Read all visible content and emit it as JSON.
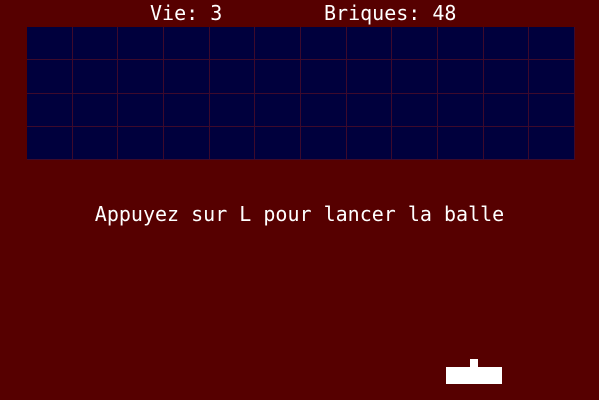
{
  "hud": {
    "lives": "Vie: 3",
    "bricks": "Briques: 48"
  },
  "game": {
    "lives_value": 3,
    "bricks_remaining": 48,
    "brick_rows": 4,
    "brick_columns": 12,
    "prompt": "Appuyez sur L pour lancer la balle"
  },
  "colors": {
    "background": "#560000",
    "bricks": "#00003d",
    "brick_lines": "#3d0a2c",
    "paddle": "#ffffff",
    "ball": "#ffffff",
    "text": "#ffffff"
  }
}
